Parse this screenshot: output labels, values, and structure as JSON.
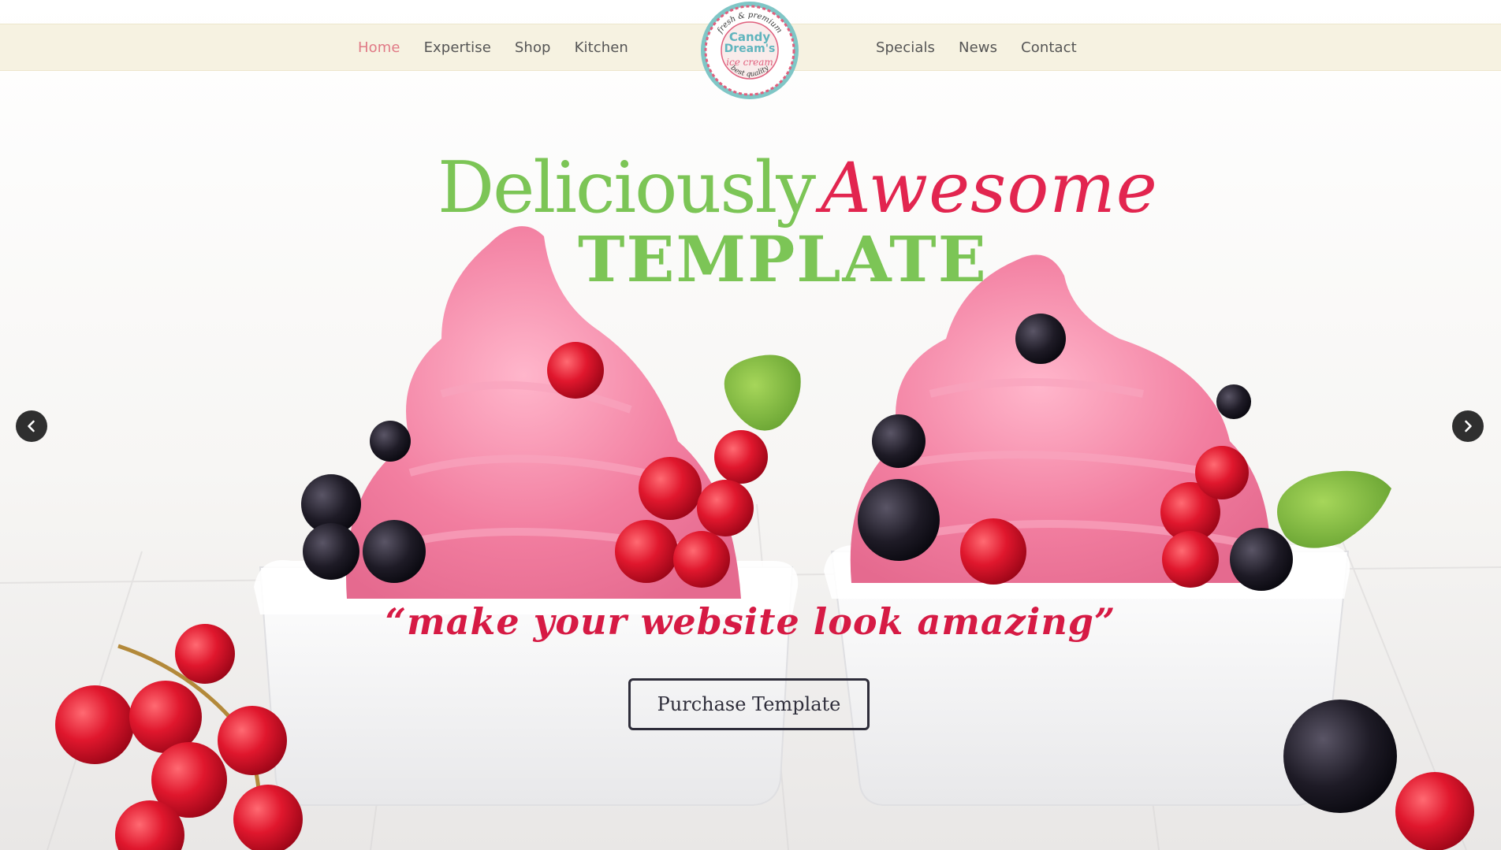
{
  "nav": {
    "left": [
      {
        "label": "Home",
        "active": true
      },
      {
        "label": "Expertise",
        "active": false
      },
      {
        "label": "Shop",
        "active": false
      },
      {
        "label": "Kitchen",
        "active": false
      }
    ],
    "right": [
      {
        "label": "Specials",
        "active": false
      },
      {
        "label": "News",
        "active": false
      },
      {
        "label": "Contact",
        "active": false
      }
    ]
  },
  "logo": {
    "top_arc": "fresh & premium",
    "name_line1": "Candy",
    "name_line2": "Dream's",
    "subtitle": "ice cream",
    "bottom_arc": "best quality"
  },
  "hero": {
    "headline_word1": "Deliciously",
    "headline_word2": "Awesome",
    "headline_line2": "TEMPLATE",
    "tagline": "“make your website look amazing”",
    "cta_label": "Purchase Template"
  },
  "slider": {
    "prev_icon": "chevron-left-icon",
    "next_icon": "chevron-right-icon"
  },
  "colors": {
    "nav_bar": "#f6f2e1",
    "nav_active": "#e07a86",
    "headline_green": "#7cc556",
    "headline_pink": "#e2254f",
    "tagline": "#d61a44",
    "button_border": "#2e2d3a"
  }
}
